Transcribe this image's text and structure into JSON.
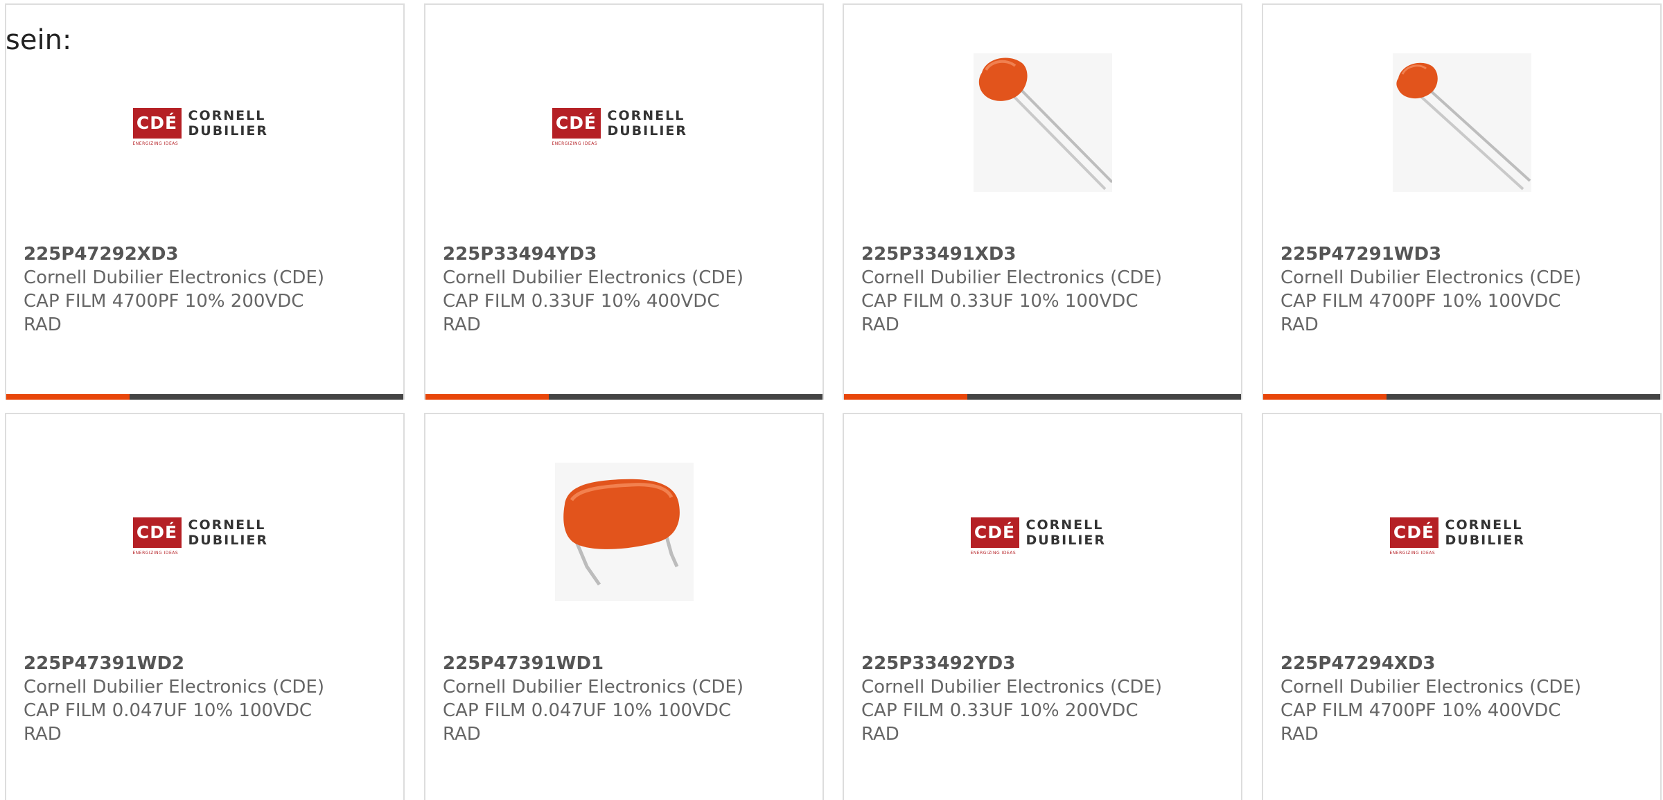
{
  "intro_text": "sein:",
  "products": [
    {
      "part_number": "225P47292XD3",
      "manufacturer": "Cornell Dubilier Electronics (CDE)",
      "description_line1": "CAP FILM 4700PF 10% 200VDC",
      "description_line2": "RAD",
      "image": "cde-logo"
    },
    {
      "part_number": "225P33494YD3",
      "manufacturer": "Cornell Dubilier Electronics (CDE)",
      "description_line1": "CAP FILM 0.33UF 10% 400VDC",
      "description_line2": "RAD",
      "image": "cde-logo"
    },
    {
      "part_number": "225P33491XD3",
      "manufacturer": "Cornell Dubilier Electronics (CDE)",
      "description_line1": "CAP FILM 0.33UF 10% 100VDC",
      "description_line2": "RAD",
      "image": "capacitor-dipped-photo"
    },
    {
      "part_number": "225P47291WD3",
      "manufacturer": "Cornell Dubilier Electronics (CDE)",
      "description_line1": "CAP FILM 4700PF 10% 100VDC",
      "description_line2": "RAD",
      "image": "capacitor-dipped-photo"
    },
    {
      "part_number": "225P47391WD2",
      "manufacturer": "Cornell Dubilier Electronics (CDE)",
      "description_line1": "CAP FILM 0.047UF 10% 100VDC",
      "description_line2": "RAD",
      "image": "cde-logo"
    },
    {
      "part_number": "225P47391WD1",
      "manufacturer": "Cornell Dubilier Electronics (CDE)",
      "description_line1": "CAP FILM 0.047UF 10% 100VDC",
      "description_line2": "RAD",
      "image": "capacitor-box-photo"
    },
    {
      "part_number": "225P33492YD3",
      "manufacturer": "Cornell Dubilier Electronics (CDE)",
      "description_line1": "CAP FILM 0.33UF 10% 200VDC",
      "description_line2": "RAD",
      "image": "cde-logo"
    },
    {
      "part_number": "225P47294XD3",
      "manufacturer": "Cornell Dubilier Electronics (CDE)",
      "description_line1": "CAP FILM 4700PF 10% 400VDC",
      "description_line2": "RAD",
      "image": "cde-logo"
    }
  ],
  "logo": {
    "box_text": "CDÉ",
    "name_line1": "CORNELL",
    "name_line2": "DUBILIER",
    "tagline": "ENERGIZING IDEAS"
  },
  "colors": {
    "accent": "#e8460a",
    "bar_dark": "#444444",
    "logo_red": "#b52025",
    "capacitor_orange": "#e2541c"
  }
}
